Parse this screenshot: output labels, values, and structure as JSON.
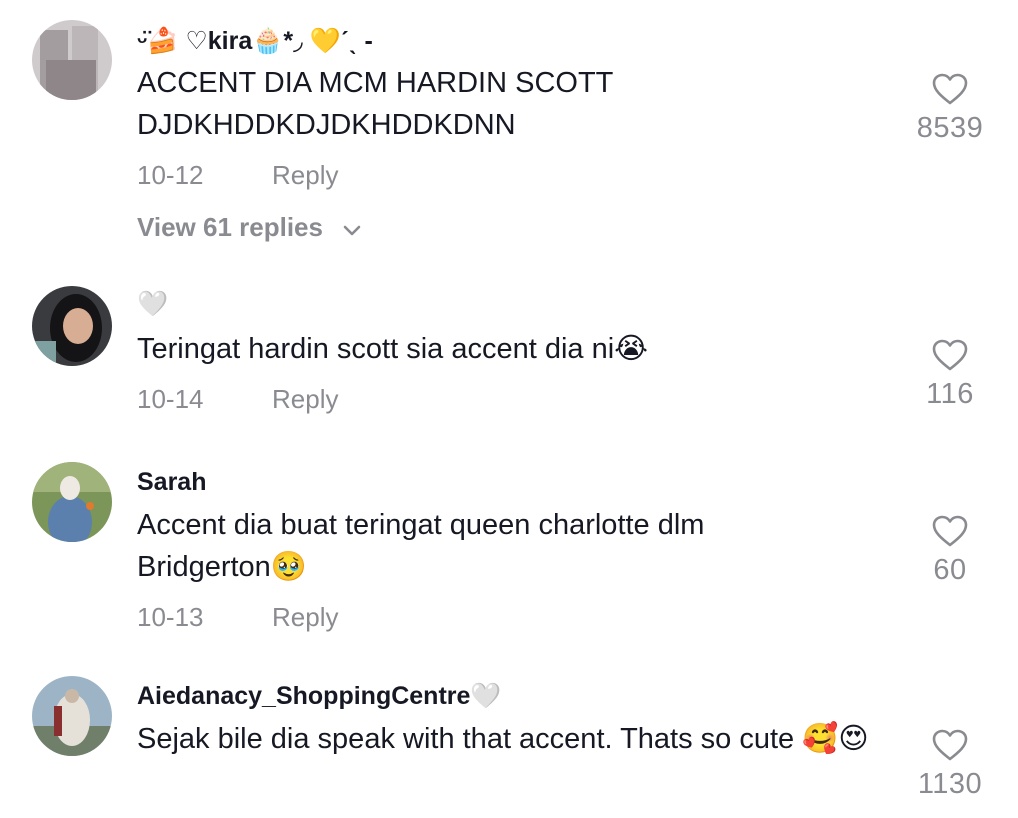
{
  "comments": [
    {
      "username": "ᵕ̈🍰 ♡kira🧁*◞ 💛ˊˎ -",
      "text": "ACCENT DIA MCM HARDIN SCOTT DJDKHDDKDJDKHDDKDNN",
      "date": "10-12",
      "reply_label": "Reply",
      "likes": "8539",
      "view_replies": "View 61 replies",
      "avatar_colors": [
        "#c9c4c6",
        "#8d8487"
      ]
    },
    {
      "username": "🤍",
      "text": "Teringat hardin scott sia accent dia ni😭",
      "date": "10-14",
      "reply_label": "Reply",
      "likes": "116",
      "avatar_colors": [
        "#2b2b2e",
        "#c59b82"
      ]
    },
    {
      "username": "Sarah",
      "text": "Accent dia buat teringat queen charlotte dlm Bridgerton🥹",
      "date": "10-13",
      "reply_label": "Reply",
      "likes": "60",
      "avatar_colors": [
        "#6f8a4c",
        "#5a7fb0"
      ]
    },
    {
      "username": "Aiedanacy_ShoppingCentre🤍",
      "text": "Sejak bile dia speak with that accent. Thats so cute 🥰😍",
      "likes": "1130",
      "avatar_colors": [
        "#8da8bf",
        "#d8d2c8"
      ]
    }
  ],
  "icons": {
    "like": "heart-outline-icon",
    "expand": "chevron-down-icon"
  }
}
